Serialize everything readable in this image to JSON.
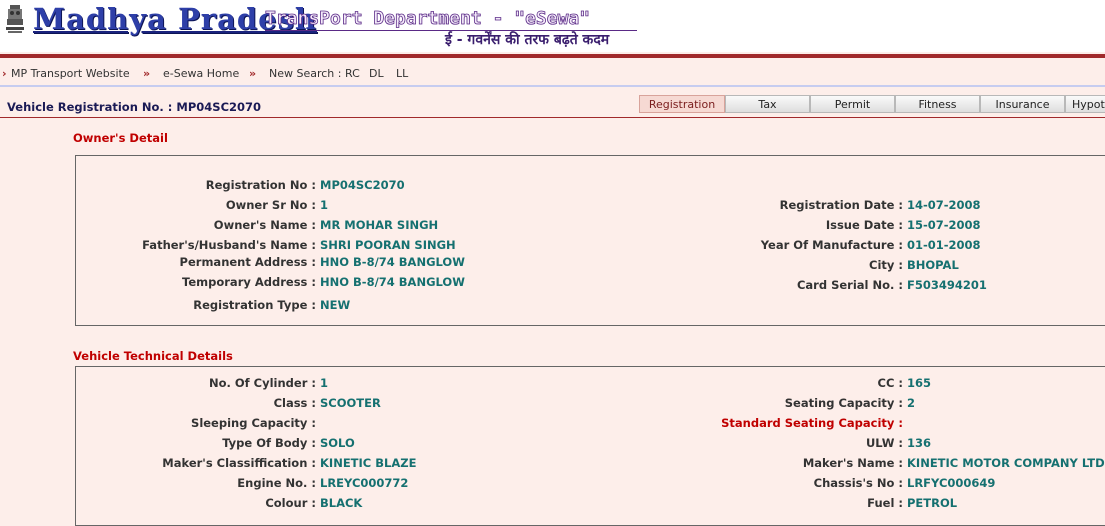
{
  "header": {
    "title_main": "Madhya Pradesh",
    "title_dept": "TransPort Department - \"eSewa\"",
    "tagline_hindi": "ई - गवर्नेंस की तरफ बढ़ते कदम"
  },
  "nav": {
    "items": [
      "MP Transport Website",
      "e-Sewa Home",
      "New Search :"
    ],
    "search_links": [
      "RC",
      "DL",
      "LL"
    ]
  },
  "vehicle": {
    "label": "Vehicle Registration No. :",
    "number": "MP04SC2070"
  },
  "tabs": [
    "Registration",
    "Tax",
    "Permit",
    "Fitness",
    "Insurance",
    "Hypoth"
  ],
  "active_tab": "Registration",
  "owner": {
    "title": "Owner's Detail",
    "left": [
      {
        "label": "Registration No :",
        "value": "MP04SC2070"
      },
      {
        "label": "Owner Sr No :",
        "value": "1"
      },
      {
        "label": "Owner's Name :",
        "value": "MR MOHAR SINGH"
      },
      {
        "label": "Father's/Husband's Name :",
        "value": "SHRI POORAN SINGH"
      },
      {
        "label": "Permanent Address :",
        "value": "HNO B-8/74 BANGLOW"
      },
      {
        "label": "Temporary Address :",
        "value": "HNO B-8/74 BANGLOW"
      },
      {
        "label": "Registration Type :",
        "value": "NEW"
      }
    ],
    "right": [
      {
        "label": "Registration Date :",
        "value": "14-07-2008"
      },
      {
        "label": "Issue Date :",
        "value": "15-07-2008"
      },
      {
        "label": "Year Of Manufacture :",
        "value": "01-01-2008"
      },
      {
        "label": "City :",
        "value": "BHOPAL"
      },
      {
        "label": "Card Serial No. :",
        "value": "F503494201"
      }
    ]
  },
  "technical": {
    "title": "Vehicle Technical Details",
    "left": [
      {
        "label": "No. Of Cylinder :",
        "value": "1"
      },
      {
        "label": "Class :",
        "value": "SCOOTER"
      },
      {
        "label": "Sleeping Capacity :",
        "value": ""
      },
      {
        "label": "Type Of Body :",
        "value": "SOLO"
      },
      {
        "label": "Maker's Classiffication :",
        "value": "KINETIC BLAZE"
      },
      {
        "label": "Engine No. :",
        "value": "LREYC000772"
      },
      {
        "label": "Colour :",
        "value": "BLACK"
      }
    ],
    "right": [
      {
        "label": "CC :",
        "value": "165"
      },
      {
        "label": "Seating Capacity :",
        "value": "2"
      },
      {
        "label": "Standard Seating Capacity :",
        "value": ""
      },
      {
        "label": "ULW :",
        "value": "136"
      },
      {
        "label": "Maker's Name :",
        "value": "KINETIC MOTOR COMPANY LTD"
      },
      {
        "label": "Chassis's No :",
        "value": "LRFYC000649"
      },
      {
        "label": "Fuel :",
        "value": "PETROL"
      }
    ]
  }
}
